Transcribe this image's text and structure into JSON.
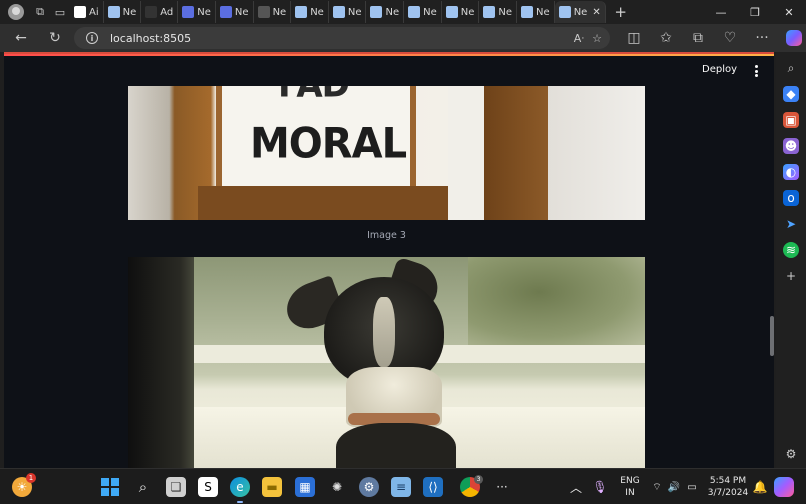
{
  "browser": {
    "tabs": [
      {
        "label": "Ai",
        "icon": "github-icon",
        "color": "#ffffff"
      },
      {
        "label": "Ne",
        "icon": "page-icon",
        "color": "#9fc3f0"
      },
      {
        "label": "Ad",
        "icon": "circle-icon",
        "color": "#333333"
      },
      {
        "label": "Ne",
        "icon": "shield-icon",
        "color": "#5b6ee1"
      },
      {
        "label": "Ne",
        "icon": "shield-icon",
        "color": "#5b6ee1"
      },
      {
        "label": "Ne",
        "icon": "page-icon",
        "color": "#555555"
      },
      {
        "label": "Ne",
        "icon": "page-icon",
        "color": "#9fc3f0"
      },
      {
        "label": "Ne",
        "icon": "page-icon",
        "color": "#9fc3f0"
      },
      {
        "label": "Ne",
        "icon": "page-icon",
        "color": "#9fc3f0"
      },
      {
        "label": "Ne",
        "icon": "page-icon",
        "color": "#9fc3f0"
      },
      {
        "label": "Ne",
        "icon": "page-icon",
        "color": "#9fc3f0"
      },
      {
        "label": "Ne",
        "icon": "page-icon",
        "color": "#9fc3f0"
      },
      {
        "label": "Ne",
        "icon": "page-icon",
        "color": "#9fc3f0"
      }
    ],
    "active_tab": {
      "label": "Ne"
    },
    "url": "localhost:8505"
  },
  "app": {
    "deploy_label": "Deploy",
    "image_3_caption": "Image 3",
    "image_3_sign_top": "FAD",
    "image_3_sign_main": "MORAL",
    "accent": "#ff4b4b"
  },
  "taskbar": {
    "weather_badge": "1",
    "chrome_badge": "3",
    "lang_line1": "ENG",
    "lang_line2": "IN",
    "time": "5:54 PM",
    "date": "3/7/2024"
  }
}
